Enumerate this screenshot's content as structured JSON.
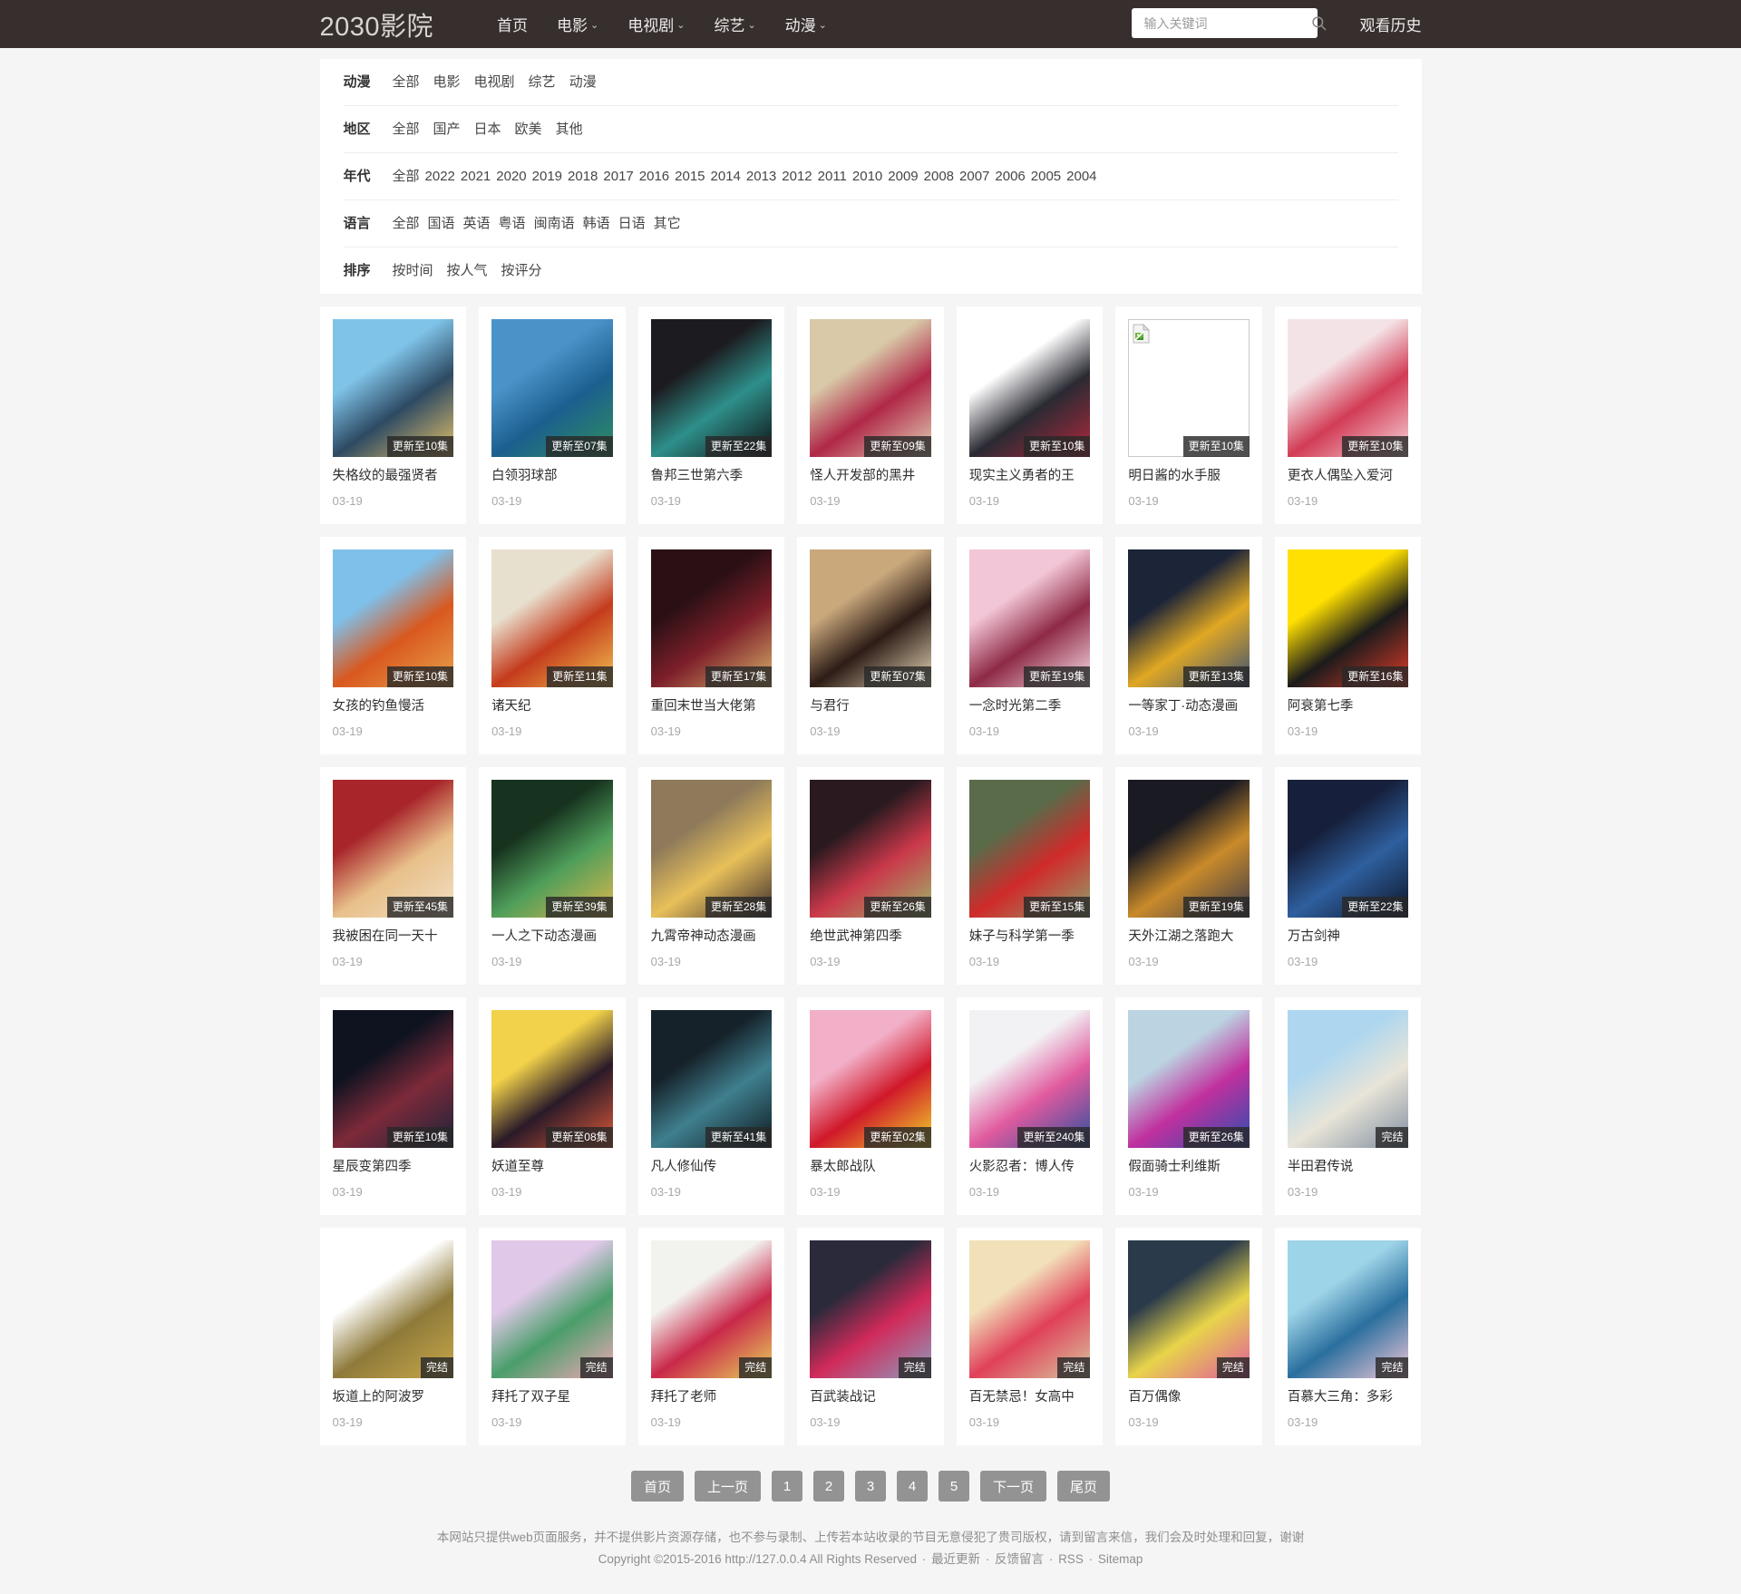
{
  "header": {
    "brand": "2030影院",
    "nav": [
      {
        "label": "首页",
        "caret": false
      },
      {
        "label": "电影",
        "caret": true
      },
      {
        "label": "电视剧",
        "caret": true
      },
      {
        "label": "综艺",
        "caret": true
      },
      {
        "label": "动漫",
        "caret": true
      }
    ],
    "search": {
      "value": "",
      "placeholder": "输入关键词",
      "icon": "search-icon"
    },
    "history_label": "观看历史"
  },
  "filters": [
    {
      "label": "动漫",
      "options": [
        "全部",
        "电影",
        "电视剧",
        "综艺",
        "动漫"
      ]
    },
    {
      "label": "地区",
      "options": [
        "全部",
        "国产",
        "日本",
        "欧美",
        "其他"
      ]
    },
    {
      "label": "年代",
      "options": [
        "全部",
        "2022",
        "2021",
        "2020",
        "2019",
        "2018",
        "2017",
        "2016",
        "2015",
        "2014",
        "2013",
        "2012",
        "2011",
        "2010",
        "2009",
        "2008",
        "2007",
        "2006",
        "2005",
        "2004"
      ]
    },
    {
      "label": "语言",
      "options": [
        "全部",
        "国语",
        "英语",
        "粤语",
        "闽南语",
        "韩语",
        "日语",
        "其它"
      ]
    },
    {
      "label": "排序",
      "options": [
        "按时间",
        "按人气",
        "按评分"
      ]
    }
  ],
  "cards": [
    {
      "title": "失格纹的最强贤者",
      "badge": "更新至10集",
      "date": "03-19",
      "broken": false,
      "c1": "#7fc3e8",
      "c2": "#2d4a63",
      "c3": "#e8c26a"
    },
    {
      "title": "白领羽球部",
      "badge": "更新至07集",
      "date": "03-19",
      "broken": false,
      "c1": "#4a93c9",
      "c2": "#1b5f8f",
      "c3": "#2f8f5f"
    },
    {
      "title": "鲁邦三世第六季",
      "badge": "更新至22集",
      "date": "03-19",
      "broken": false,
      "c1": "#1c1c20",
      "c2": "#2e8f8a",
      "c3": "#0e0e12"
    },
    {
      "title": "怪人开发部的黑井",
      "badge": "更新至09集",
      "date": "03-19",
      "broken": false,
      "c1": "#d9c9a8",
      "c2": "#b02848",
      "c3": "#e3d4b6"
    },
    {
      "title": "现实主义勇者的王",
      "badge": "更新至10集",
      "date": "03-19",
      "broken": false,
      "c1": "#ffffff",
      "c2": "#2a2a33",
      "c3": "#b2283c"
    },
    {
      "title": "明日酱的水手服",
      "badge": "更新至10集",
      "date": "03-19",
      "broken": true,
      "c1": "#ffffff",
      "c2": "#ffffff",
      "c3": "#ffffff"
    },
    {
      "title": "更衣人偶坠入爱河",
      "badge": "更新至10集",
      "date": "03-19",
      "broken": false,
      "c1": "#f4e3e6",
      "c2": "#d23c55",
      "c3": "#f8d6dc"
    },
    {
      "title": "女孩的钓鱼慢活",
      "badge": "更新至10集",
      "date": "03-19",
      "broken": false,
      "c1": "#7fc0ea",
      "c2": "#d9581f",
      "c3": "#e8a44c"
    },
    {
      "title": "诸天纪",
      "badge": "更新至11集",
      "date": "03-19",
      "broken": false,
      "c1": "#e8e0cf",
      "c2": "#c43b1c",
      "c3": "#f2c351"
    },
    {
      "title": "重回末世当大佬第",
      "badge": "更新至17集",
      "date": "03-19",
      "broken": false,
      "c1": "#2a1014",
      "c2": "#7d1f2a",
      "c3": "#d9b26a"
    },
    {
      "title": "与君行",
      "badge": "更新至07集",
      "date": "03-19",
      "broken": false,
      "c1": "#c9a87c",
      "c2": "#2d1c16",
      "c3": "#e8d9b8"
    },
    {
      "title": "一念时光第二季",
      "badge": "更新至19集",
      "date": "03-19",
      "broken": false,
      "c1": "#f2c6d6",
      "c2": "#8e2a46",
      "c3": "#f9e0e8"
    },
    {
      "title": "一等家丁·动态漫画",
      "badge": "更新至13集",
      "date": "03-19",
      "broken": false,
      "c1": "#1c2438",
      "c2": "#e0a823",
      "c3": "#3a4f78"
    },
    {
      "title": "阿衰第七季",
      "badge": "更新至16集",
      "date": "03-19",
      "broken": false,
      "c1": "#ffe000",
      "c2": "#1b1b1b",
      "c3": "#e23c2a"
    },
    {
      "title": "我被困在同一天十",
      "badge": "更新至45集",
      "date": "03-19",
      "broken": false,
      "c1": "#a8252a",
      "c2": "#e8c08a",
      "c3": "#f2e0c6"
    },
    {
      "title": "一人之下动态漫画",
      "badge": "更新至39集",
      "date": "03-19",
      "broken": false,
      "c1": "#17331f",
      "c2": "#4f9e5a",
      "c3": "#e0b84c"
    },
    {
      "title": "九霄帝神动态漫画",
      "badge": "更新至28集",
      "date": "03-19",
      "broken": false,
      "c1": "#8e7a5a",
      "c2": "#e8c05a",
      "c3": "#3a2a2f"
    },
    {
      "title": "绝世武神第四季",
      "badge": "更新至26集",
      "date": "03-19",
      "broken": false,
      "c1": "#2a1a1f",
      "c2": "#c9384a",
      "c3": "#9eb86a"
    },
    {
      "title": "妹子与科学第一季",
      "badge": "更新至15集",
      "date": "03-19",
      "broken": false,
      "c1": "#5a6b4a",
      "c2": "#d02a2a",
      "c3": "#8fa36e"
    },
    {
      "title": "天外江湖之落跑大",
      "badge": "更新至19集",
      "date": "03-19",
      "broken": false,
      "c1": "#1a1a22",
      "c2": "#c98a2a",
      "c3": "#3a3a4a"
    },
    {
      "title": "万古剑神",
      "badge": "更新至22集",
      "date": "03-19",
      "broken": false,
      "c1": "#16203c",
      "c2": "#2e5f9e",
      "c3": "#0d1426"
    },
    {
      "title": "星辰变第四季",
      "badge": "更新至10集",
      "date": "03-19",
      "broken": false,
      "c1": "#0f1320",
      "c2": "#7d2a3a",
      "c3": "#1c2338"
    },
    {
      "title": "妖道至尊",
      "badge": "更新至08集",
      "date": "03-19",
      "broken": false,
      "c1": "#f2d24a",
      "c2": "#2a1a28",
      "c3": "#e05a3a"
    },
    {
      "title": "凡人修仙传",
      "badge": "更新至41集",
      "date": "03-19",
      "broken": false,
      "c1": "#16222a",
      "c2": "#3f7f8e",
      "c3": "#0e1a20"
    },
    {
      "title": "暴太郎战队",
      "badge": "更新至02集",
      "date": "03-19",
      "broken": false,
      "c1": "#f2b0c8",
      "c2": "#d0182a",
      "c3": "#f2d82a"
    },
    {
      "title": "火影忍者：博人传",
      "badge": "更新至240集",
      "date": "03-19",
      "broken": false,
      "c1": "#f2f2f4",
      "c2": "#e05a9e",
      "c3": "#2a4f9e"
    },
    {
      "title": "假面骑士利维斯",
      "badge": "更新至26集",
      "date": "03-19",
      "broken": false,
      "c1": "#bcd4e2",
      "c2": "#c0309e",
      "c3": "#2a4fb0"
    },
    {
      "title": "半田君传说",
      "badge": "完结",
      "date": "03-19",
      "broken": false,
      "c1": "#aed7ef",
      "c2": "#e8e4d8",
      "c3": "#7f8fa0"
    },
    {
      "title": "坂道上的阿波罗",
      "badge": "完结",
      "date": "03-19",
      "broken": false,
      "c1": "#ffffff",
      "c2": "#8e7a3a",
      "c3": "#c9a84a"
    },
    {
      "title": "拜托了双子星",
      "badge": "完结",
      "date": "03-19",
      "broken": false,
      "c1": "#e0c8e8",
      "c2": "#4a9e6a",
      "c3": "#f2a8b8"
    },
    {
      "title": "拜托了老师",
      "badge": "完结",
      "date": "03-19",
      "broken": false,
      "c1": "#f2f2ee",
      "c2": "#c9284a",
      "c3": "#e8d45a"
    },
    {
      "title": "百武装战记",
      "badge": "完结",
      "date": "03-19",
      "broken": false,
      "c1": "#2a2a3a",
      "c2": "#d02a5a",
      "c3": "#8e9ec0"
    },
    {
      "title": "百无禁忌！女高中",
      "badge": "完结",
      "date": "03-19",
      "broken": false,
      "c1": "#f2e0b8",
      "c2": "#e0405a",
      "c3": "#d8c89e"
    },
    {
      "title": "百万偶像",
      "badge": "完结",
      "date": "03-19",
      "broken": false,
      "c1": "#2a3a4a",
      "c2": "#e8d44a",
      "c3": "#e05a9e"
    },
    {
      "title": "百慕大三角：多彩",
      "badge": "完结",
      "date": "03-19",
      "broken": false,
      "c1": "#9ed4e8",
      "c2": "#2a6f9e",
      "c3": "#f2c8d8"
    }
  ],
  "pager": [
    {
      "label": "首页",
      "kind": "text"
    },
    {
      "label": "上一页",
      "kind": "text"
    },
    {
      "label": "1",
      "kind": "num"
    },
    {
      "label": "2",
      "kind": "num"
    },
    {
      "label": "3",
      "kind": "num"
    },
    {
      "label": "4",
      "kind": "num"
    },
    {
      "label": "5",
      "kind": "num"
    },
    {
      "label": "下一页",
      "kind": "text"
    },
    {
      "label": "尾页",
      "kind": "text"
    }
  ],
  "footer": {
    "disclaimer": "本网站只提供web页面服务，并不提供影片资源存储，也不参与录制、上传若本站收录的节目无意侵犯了贵司版权，请到留言来信，我们会及时处理和回复，谢谢",
    "copyright": "Copyright ©2015-2016 http://127.0.0.4 All Rights Reserved",
    "links": [
      "最近更新",
      "反馈留言",
      "RSS",
      "Sitemap"
    ]
  }
}
